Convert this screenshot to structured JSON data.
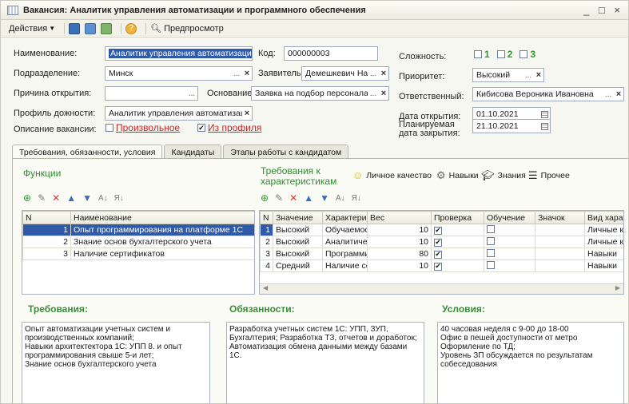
{
  "window": {
    "title": "Вакансия: Аналитик управления автоматизации и программного обеспечения",
    "controls": "_ □ ×"
  },
  "toolbar": {
    "actions": "Действия",
    "preview": "Предпросмотр"
  },
  "form": {
    "name_label": "Наименование:",
    "name_value": "Аналитик управления автоматизации и п",
    "code_label": "Код:",
    "code_value": "000000003",
    "division_label": "Подразделение:",
    "division_value": "Минск",
    "applicant_label": "Заявитель:",
    "applicant_value": "Демешкевич Нат",
    "reason_label": "Причина открытия:",
    "reason_value": "",
    "basis_label": "Основание:",
    "basis_value": "Заявка на подбор персонала 000",
    "profile_label": "Профиль дожности:",
    "profile_value": "Аналитик управления автоматизац",
    "desc_label": "Описание вакансии:",
    "desc_free": "Произвольное",
    "desc_profile": "Из профиля",
    "complexity_label": "Сложность:",
    "complexity_options": [
      "1",
      "2",
      "3"
    ],
    "priority_label": "Приоритет:",
    "priority_value": "Высокий",
    "responsible_label": "Ответственный:",
    "responsible_value": "Кибисова Вероника Ивановна",
    "open_date_label": "Дата открытия:",
    "open_date_value": "01.10.2021",
    "close_date_label": "Планируемая дата закрытия:",
    "close_date_value": "21.10.2021",
    "ellipsis": "...",
    "clear": "×"
  },
  "tabs": [
    "Требования, обязанности, условия",
    "Кандидаты",
    "Этапы работы с кандидатом"
  ],
  "functions": {
    "title": "Функции",
    "columns": [
      "N",
      "Наименование"
    ],
    "rows": [
      {
        "n": "1",
        "name": "Опыт программирования на платформе 1С"
      },
      {
        "n": "2",
        "name": "Знание основ бухгалтерского учета"
      },
      {
        "n": "3",
        "name": "Наличие сертификатов"
      }
    ]
  },
  "reqchars": {
    "title": "Требования к характеристикам",
    "legend": [
      "Личное качество",
      "Навыки",
      "Знания",
      "Прочее"
    ],
    "columns": [
      "N",
      "Значение",
      "Характерис...",
      "Вес",
      "Проверка",
      "Обучение",
      "Значок",
      "Вид характ"
    ],
    "rows": [
      {
        "n": "1",
        "value": "Высокий",
        "char": "Обучаемос...",
        "weight": "10",
        "check": "✔",
        "train": "",
        "icon": "",
        "kind": "Личные ка"
      },
      {
        "n": "2",
        "value": "Высокий",
        "char": "Аналитичес...",
        "weight": "10",
        "check": "✔",
        "train": "",
        "icon": "",
        "kind": "Личные ка"
      },
      {
        "n": "3",
        "value": "Высокий",
        "char": "Программи...",
        "weight": "80",
        "check": "✔",
        "train": "",
        "icon": "",
        "kind": "Навыки"
      },
      {
        "n": "4",
        "value": "Средний",
        "char": "Наличие се...",
        "weight": "10",
        "check": "✔",
        "train": "",
        "icon": "",
        "kind": "Навыки"
      }
    ]
  },
  "requirements": {
    "title": "Требования:",
    "text": "Опыт автоматизации учетных систем и\nпроизводственных компаний;\nНавыки архитектектора 1С: УПП 8. и опыт\nпрограммирования свыше 5-и лет;\nЗнание основ бухгалтерского учета"
  },
  "duties": {
    "title": "Обязанности:",
    "text": "Разработка учетных систем 1С: УПП, ЗУП,\nБухгалтерия; Разработка ТЗ, отчетов и доработок;\nАвтоматизация обмена данными между базами 1С."
  },
  "conditions": {
    "title": "Условия:",
    "text": "40 часовая неделя с 9-00 до 18-00\nОфис в пешей доступности от метро\nОформление по ТД;\nУровень ЗП обсуждается по результатам\nсобеседования"
  },
  "colors": {
    "accent": "#2f5aa8",
    "green": "#2f8a2f",
    "red": "#c12b2b"
  }
}
